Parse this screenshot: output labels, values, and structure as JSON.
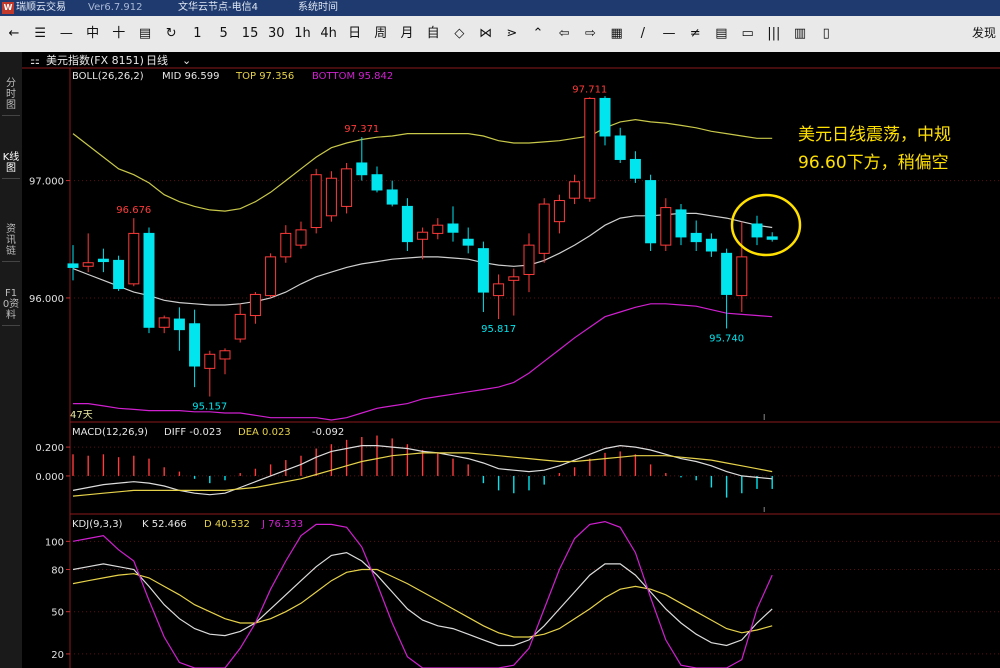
{
  "window": {
    "app_title": "瑞顺云交易",
    "version": "Ver6.7.912",
    "node": "文华云节点-电信4",
    "menu_system": "系统时间",
    "right_button": "发现"
  },
  "toolbar": {
    "buttons": [
      {
        "name": "back",
        "label": "←"
      },
      {
        "name": "list",
        "label": "☰"
      },
      {
        "name": "minus",
        "label": "—"
      },
      {
        "name": "candle",
        "label": "中"
      },
      {
        "name": "cross",
        "label": "十"
      },
      {
        "name": "save",
        "label": "▤"
      },
      {
        "name": "refresh",
        "label": "↻"
      },
      {
        "name": "p1",
        "label": "1"
      },
      {
        "name": "p5",
        "label": "5"
      },
      {
        "name": "p15",
        "label": "15"
      },
      {
        "name": "p30",
        "label": "30"
      },
      {
        "name": "p1h",
        "label": "1h"
      },
      {
        "name": "p4h",
        "label": "4h"
      },
      {
        "name": "day",
        "label": "日"
      },
      {
        "name": "week",
        "label": "周"
      },
      {
        "name": "month",
        "label": "月"
      },
      {
        "name": "custom",
        "label": "自"
      },
      {
        "name": "zoom-in",
        "label": "◇"
      },
      {
        "name": "zoom-out",
        "label": "⋈"
      },
      {
        "name": "shrink",
        "label": "⋗"
      },
      {
        "name": "expand",
        "label": "⌃"
      },
      {
        "name": "left",
        "label": "⇦"
      },
      {
        "name": "right",
        "label": "⇨"
      },
      {
        "name": "layout",
        "label": "▦"
      },
      {
        "name": "line",
        "label": "/"
      },
      {
        "name": "hline",
        "label": "—"
      },
      {
        "name": "channel",
        "label": "≠"
      },
      {
        "name": "text",
        "label": "▤"
      },
      {
        "name": "fib",
        "label": "▭"
      },
      {
        "name": "bars",
        "label": "|||"
      },
      {
        "name": "volume",
        "label": "▥"
      },
      {
        "name": "tools",
        "label": "▯"
      }
    ]
  },
  "left_tabs": [
    "分时图",
    "K线图",
    "资讯链",
    "F10资料"
  ],
  "header": {
    "symbol": "美元指数(FX 8151)",
    "period": "日线"
  },
  "boll": {
    "label": "BOLL(26,26,2)",
    "mid": "MID 96.599",
    "top": "TOP 97.356",
    "bottom": "BOTTOM 95.842"
  },
  "macd": {
    "label": "MACD(12,26,9)",
    "diff": "DIFF -0.023",
    "dea": "DEA 0.023",
    "macd": "-0.092"
  },
  "kdj": {
    "label": "KDJ(9,3,3)",
    "k": "K 52.466",
    "d": "D 40.532",
    "j": "J 76.333"
  },
  "annotation": {
    "line1": "美元日线震荡，中规",
    "line2": "96.60下方，稍偏空"
  },
  "bars_label": "47天",
  "colors": {
    "up": "#ff3b3b",
    "down": "#00e5ee",
    "boll_top": "#c8c84a",
    "boll_mid": "#cfcfcf",
    "boll_bottom": "#d020d0",
    "annotation": "#ffe000"
  },
  "chart_data": {
    "type": "candlestick",
    "main": {
      "y_ticks": [
        96.0,
        97.0
      ],
      "y_tick_labels": [
        "96.000",
        "97.000"
      ],
      "ylim": [
        94.96,
        97.84
      ],
      "candles": [
        {
          "o": 96.29,
          "h": 96.45,
          "l": 96.15,
          "c": 96.26
        },
        {
          "o": 96.27,
          "h": 96.55,
          "l": 96.22,
          "c": 96.3
        },
        {
          "o": 96.33,
          "h": 96.42,
          "l": 96.22,
          "c": 96.31
        },
        {
          "o": 96.32,
          "h": 96.36,
          "l": 96.06,
          "c": 96.08
        },
        {
          "o": 96.12,
          "h": 96.68,
          "l": 96.1,
          "c": 96.55
        },
        {
          "o": 96.55,
          "h": 96.6,
          "l": 95.7,
          "c": 95.75
        },
        {
          "o": 95.75,
          "h": 95.85,
          "l": 95.7,
          "c": 95.83
        },
        {
          "o": 95.82,
          "h": 95.92,
          "l": 95.55,
          "c": 95.73
        },
        {
          "o": 95.78,
          "h": 95.9,
          "l": 95.24,
          "c": 95.42
        },
        {
          "o": 95.4,
          "h": 95.55,
          "l": 95.16,
          "c": 95.52
        },
        {
          "o": 95.48,
          "h": 95.57,
          "l": 95.35,
          "c": 95.55
        },
        {
          "o": 95.65,
          "h": 95.95,
          "l": 95.62,
          "c": 95.86
        },
        {
          "o": 95.85,
          "h": 96.05,
          "l": 95.78,
          "c": 96.03
        },
        {
          "o": 96.02,
          "h": 96.38,
          "l": 96.0,
          "c": 96.35
        },
        {
          "o": 96.35,
          "h": 96.62,
          "l": 96.3,
          "c": 96.55
        },
        {
          "o": 96.45,
          "h": 96.65,
          "l": 96.42,
          "c": 96.58
        },
        {
          "o": 96.6,
          "h": 97.1,
          "l": 96.55,
          "c": 97.05
        },
        {
          "o": 96.7,
          "h": 97.08,
          "l": 96.65,
          "c": 97.02
        },
        {
          "o": 96.78,
          "h": 97.15,
          "l": 96.72,
          "c": 97.1
        },
        {
          "o": 97.15,
          "h": 97.37,
          "l": 97.0,
          "c": 97.05
        },
        {
          "o": 97.05,
          "h": 97.12,
          "l": 96.9,
          "c": 96.92
        },
        {
          "o": 96.92,
          "h": 97.0,
          "l": 96.78,
          "c": 96.8
        },
        {
          "o": 96.78,
          "h": 96.85,
          "l": 96.4,
          "c": 96.48
        },
        {
          "o": 96.5,
          "h": 96.6,
          "l": 96.33,
          "c": 96.56
        },
        {
          "o": 96.55,
          "h": 96.68,
          "l": 96.5,
          "c": 96.62
        },
        {
          "o": 96.63,
          "h": 96.78,
          "l": 96.48,
          "c": 96.56
        },
        {
          "o": 96.5,
          "h": 96.6,
          "l": 96.38,
          "c": 96.45
        },
        {
          "o": 96.42,
          "h": 96.48,
          "l": 95.88,
          "c": 96.05
        },
        {
          "o": 96.02,
          "h": 96.2,
          "l": 95.82,
          "c": 96.12
        },
        {
          "o": 96.15,
          "h": 96.25,
          "l": 95.85,
          "c": 96.18
        },
        {
          "o": 96.2,
          "h": 96.55,
          "l": 96.05,
          "c": 96.45
        },
        {
          "o": 96.38,
          "h": 96.85,
          "l": 96.3,
          "c": 96.8
        },
        {
          "o": 96.65,
          "h": 96.88,
          "l": 96.55,
          "c": 96.83
        },
        {
          "o": 96.85,
          "h": 97.05,
          "l": 96.8,
          "c": 96.99
        },
        {
          "o": 96.85,
          "h": 97.71,
          "l": 96.82,
          "c": 97.7
        },
        {
          "o": 97.7,
          "h": 97.72,
          "l": 97.3,
          "c": 97.38
        },
        {
          "o": 97.38,
          "h": 97.45,
          "l": 97.15,
          "c": 97.18
        },
        {
          "o": 97.18,
          "h": 97.25,
          "l": 96.98,
          "c": 97.02
        },
        {
          "o": 97.0,
          "h": 97.05,
          "l": 96.4,
          "c": 96.47
        },
        {
          "o": 96.45,
          "h": 96.85,
          "l": 96.4,
          "c": 96.77
        },
        {
          "o": 96.75,
          "h": 96.8,
          "l": 96.45,
          "c": 96.52
        },
        {
          "o": 96.55,
          "h": 96.66,
          "l": 96.4,
          "c": 96.48
        },
        {
          "o": 96.5,
          "h": 96.55,
          "l": 96.35,
          "c": 96.4
        },
        {
          "o": 96.38,
          "h": 96.42,
          "l": 95.74,
          "c": 96.03
        },
        {
          "o": 96.02,
          "h": 96.65,
          "l": 95.88,
          "c": 96.35
        },
        {
          "o": 96.63,
          "h": 96.7,
          "l": 96.45,
          "c": 96.52
        },
        {
          "o": 96.52,
          "h": 96.56,
          "l": 96.48,
          "c": 96.5
        }
      ],
      "price_labels": [
        {
          "text": "96.676",
          "index": 4,
          "at": "high",
          "color": "up"
        },
        {
          "text": "95.157",
          "index": 9,
          "at": "low",
          "color": "down"
        },
        {
          "text": "97.371",
          "index": 19,
          "at": "high",
          "color": "up"
        },
        {
          "text": "95.817",
          "index": 28,
          "at": "low",
          "color": "down"
        },
        {
          "text": "97.711",
          "index": 34,
          "at": "high",
          "color": "up"
        },
        {
          "text": "95.740",
          "index": 43,
          "at": "low",
          "color": "down"
        }
      ],
      "boll_top": [
        97.4,
        97.3,
        97.2,
        97.1,
        97.05,
        96.98,
        96.88,
        96.82,
        96.78,
        96.75,
        96.74,
        96.76,
        96.82,
        96.9,
        97.0,
        97.1,
        97.2,
        97.28,
        97.32,
        97.35,
        97.37,
        97.38,
        97.4,
        97.4,
        97.4,
        97.4,
        97.4,
        97.38,
        97.34,
        97.32,
        97.32,
        97.33,
        97.34,
        97.36,
        97.38,
        97.45,
        97.5,
        97.52,
        97.5,
        97.49,
        97.47,
        97.45,
        97.42,
        97.4,
        97.38,
        97.36,
        97.36
      ],
      "boll_mid": [
        96.25,
        96.2,
        96.15,
        96.1,
        96.05,
        96.02,
        95.98,
        95.96,
        95.95,
        95.94,
        95.94,
        95.95,
        95.97,
        96.0,
        96.05,
        96.12,
        96.18,
        96.22,
        96.26,
        96.29,
        96.31,
        96.33,
        96.34,
        96.35,
        96.35,
        96.34,
        96.33,
        96.3,
        96.28,
        96.27,
        96.28,
        96.32,
        96.38,
        96.45,
        96.53,
        96.62,
        96.68,
        96.7,
        96.7,
        96.71,
        96.72,
        96.72,
        96.7,
        96.68,
        96.65,
        96.62,
        96.6
      ],
      "boll_bottom": [
        95.1,
        95.1,
        95.08,
        95.06,
        95.05,
        95.04,
        95.04,
        95.04,
        95.03,
        95.03,
        95.02,
        95.02,
        95.0,
        94.98,
        94.98,
        94.98,
        94.98,
        94.96,
        94.98,
        95.02,
        95.06,
        95.08,
        95.1,
        95.14,
        95.16,
        95.18,
        95.2,
        95.22,
        95.24,
        95.28,
        95.36,
        95.46,
        95.56,
        95.66,
        95.75,
        95.84,
        95.88,
        95.92,
        95.95,
        95.95,
        95.94,
        95.93,
        95.9,
        95.87,
        95.86,
        95.85,
        95.84
      ]
    },
    "macd": {
      "y_ticks": [
        0.2,
        0.0
      ],
      "y_tick_labels": [
        "0.200",
        "0.000"
      ],
      "ylim": [
        -0.25,
        0.36
      ],
      "hist": [
        0.15,
        0.14,
        0.15,
        0.13,
        0.14,
        0.12,
        0.06,
        0.03,
        -0.02,
        -0.05,
        -0.03,
        0.02,
        0.05,
        0.08,
        0.11,
        0.14,
        0.19,
        0.22,
        0.25,
        0.27,
        0.28,
        0.26,
        0.22,
        0.18,
        0.16,
        0.12,
        0.08,
        -0.05,
        -0.1,
        -0.12,
        -0.1,
        -0.06,
        0.02,
        0.06,
        0.12,
        0.16,
        0.17,
        0.15,
        0.08,
        0.02,
        -0.01,
        -0.03,
        -0.08,
        -0.15,
        -0.12,
        -0.09,
        -0.09
      ],
      "diff": [
        -0.1,
        -0.08,
        -0.06,
        -0.05,
        -0.04,
        -0.05,
        -0.07,
        -0.1,
        -0.12,
        -0.13,
        -0.12,
        -0.08,
        -0.04,
        0.0,
        0.04,
        0.08,
        0.13,
        0.17,
        0.19,
        0.21,
        0.21,
        0.2,
        0.19,
        0.17,
        0.16,
        0.14,
        0.12,
        0.09,
        0.05,
        0.04,
        0.03,
        0.04,
        0.07,
        0.11,
        0.15,
        0.19,
        0.21,
        0.2,
        0.18,
        0.15,
        0.12,
        0.1,
        0.07,
        0.03,
        0.0,
        -0.01,
        -0.02
      ],
      "dea": [
        -0.14,
        -0.13,
        -0.12,
        -0.11,
        -0.1,
        -0.1,
        -0.1,
        -0.1,
        -0.1,
        -0.1,
        -0.1,
        -0.09,
        -0.08,
        -0.06,
        -0.04,
        -0.02,
        0.01,
        0.04,
        0.07,
        0.1,
        0.12,
        0.14,
        0.15,
        0.16,
        0.16,
        0.16,
        0.16,
        0.15,
        0.14,
        0.13,
        0.12,
        0.11,
        0.1,
        0.1,
        0.11,
        0.12,
        0.13,
        0.14,
        0.14,
        0.14,
        0.13,
        0.12,
        0.11,
        0.09,
        0.07,
        0.05,
        0.03
      ]
    },
    "kdj": {
      "y_ticks": [
        100,
        80,
        50,
        20
      ],
      "y_tick_labels": [
        "100",
        "80",
        "50",
        "20"
      ],
      "ylim": [
        10,
        118
      ],
      "k": [
        80,
        82,
        84,
        82,
        80,
        68,
        55,
        45,
        38,
        34,
        33,
        36,
        42,
        52,
        62,
        72,
        82,
        90,
        92,
        86,
        76,
        64,
        52,
        44,
        40,
        38,
        34,
        30,
        26,
        26,
        30,
        40,
        52,
        64,
        76,
        84,
        84,
        76,
        64,
        52,
        42,
        34,
        28,
        26,
        30,
        42,
        52
      ],
      "d": [
        70,
        72,
        74,
        76,
        77,
        74,
        68,
        62,
        55,
        50,
        45,
        42,
        42,
        45,
        50,
        56,
        64,
        72,
        78,
        80,
        80,
        75,
        70,
        64,
        58,
        52,
        46,
        40,
        35,
        32,
        32,
        34,
        38,
        45,
        52,
        60,
        66,
        68,
        66,
        62,
        56,
        50,
        44,
        38,
        35,
        37,
        40
      ],
      "j": [
        100,
        102,
        104,
        94,
        86,
        58,
        32,
        14,
        4,
        2,
        8,
        24,
        42,
        66,
        86,
        104,
        112,
        112,
        110,
        96,
        70,
        42,
        18,
        6,
        4,
        8,
        10,
        10,
        8,
        12,
        24,
        52,
        80,
        102,
        112,
        114,
        110,
        92,
        60,
        30,
        12,
        2,
        0,
        0,
        16,
        52,
        76
      ]
    }
  }
}
